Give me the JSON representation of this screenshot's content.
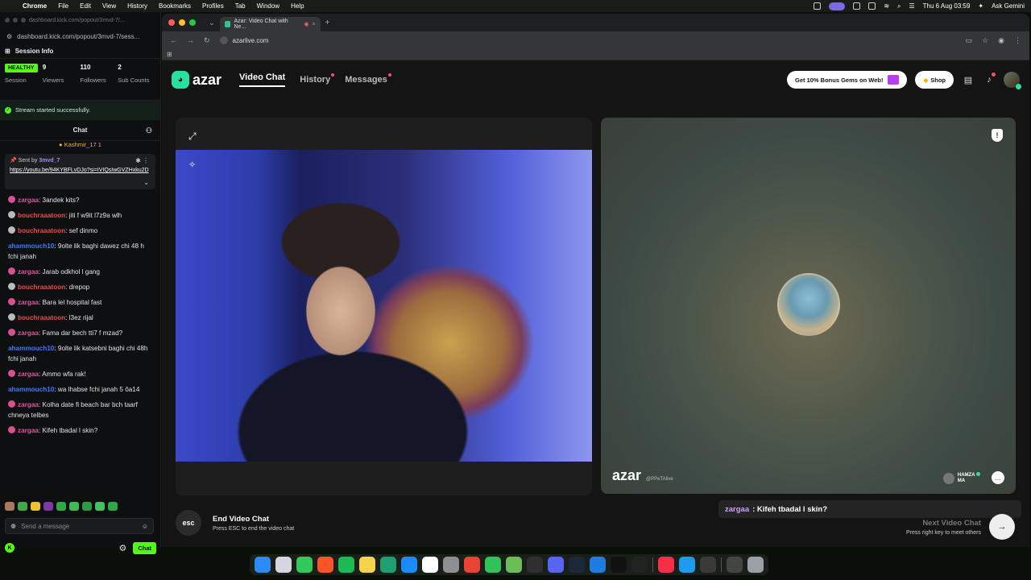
{
  "menubar": {
    "app": "Chrome",
    "items": [
      "File",
      "Edit",
      "View",
      "History",
      "Bookmarks",
      "Profiles",
      "Tab",
      "Window",
      "Help"
    ],
    "clock": "Thu 6 Aug  03:59",
    "gemini": "Ask Gemini"
  },
  "kick": {
    "title_url": "dashboard.kick.com/popout/3mvd-7/...",
    "url": "dashboard.kick.com/popout/3mvd-7/sess...",
    "section_title": "Session Info",
    "stats": [
      {
        "value": "HEALTHY",
        "label": "Session"
      },
      {
        "value": "9",
        "label": "Viewers"
      },
      {
        "value": "110",
        "label": "Followers"
      },
      {
        "value": "2",
        "label": "Sub Counts"
      }
    ],
    "stream_status": "Stream started successfully.",
    "chat_title": "Chat",
    "pinned_user": "Kashmir_17",
    "pinned_count": "1",
    "pinned_sent_by_prefix": "Sent by",
    "pinned_sent_by": "3mvd_7",
    "pinned_link": "https://youtu.be/94KYBFLvDJo?si=IVIQsIwGVZHxku2D",
    "messages": [
      {
        "user": "zargaa",
        "text": "3andek kits?",
        "color": "pink",
        "avatar": "pink"
      },
      {
        "user": "bouchraaatoon",
        "text": "jiti f w9it l7z9a wlh",
        "color": "red",
        "avatar": "grey"
      },
      {
        "user": "bouchraaatoon",
        "text": "sef dinmo",
        "color": "red",
        "avatar": "grey"
      },
      {
        "user": "ahammouch10",
        "text": "9olte lik baghi dawez chi 48 h fchi janah",
        "color": "blue",
        "avatar": ""
      },
      {
        "user": "zargaa",
        "text": "Jarab odkhol l gang",
        "color": "pink",
        "avatar": "pink"
      },
      {
        "user": "bouchraaatoon",
        "text": "drepop",
        "color": "red",
        "avatar": "grey"
      },
      {
        "user": "zargaa",
        "text": "Bara lel hospital fast",
        "color": "pink",
        "avatar": "pink"
      },
      {
        "user": "bouchraaatoon",
        "text": "l3ez rijal",
        "color": "red",
        "avatar": "grey"
      },
      {
        "user": "zargaa",
        "text": "Fama dar bech tti7 f mzad?",
        "color": "pink",
        "avatar": "pink"
      },
      {
        "user": "ahammouch10",
        "text": "9olte lik katsebni baghi chi 48h fchi janah",
        "color": "blue",
        "avatar": ""
      },
      {
        "user": "zargaa",
        "text": "Ammo wfa rak!",
        "color": "pink",
        "avatar": "pink"
      },
      {
        "user": "ahammouch10",
        "text": "wa lhabse fchi janah 5 ôa14",
        "color": "blue",
        "avatar": ""
      },
      {
        "user": "zargaa",
        "text": "Kolha date fi beach bar bch taarf chneya telbes",
        "color": "pink",
        "avatar": "pink"
      },
      {
        "user": "zargaa",
        "text": "Kifeh tbadal l skin?",
        "color": "pink",
        "avatar": "pink"
      }
    ],
    "send_placeholder": "Send a message",
    "chat_button": "Chat"
  },
  "chrome": {
    "tab_title": "Azar: Video Chat with Ne...",
    "url": "azarlive.com"
  },
  "azar": {
    "logo": "azar",
    "nav": [
      {
        "label": "Video Chat",
        "active": true,
        "dot": false
      },
      {
        "label": "History",
        "active": false,
        "dot": true
      },
      {
        "label": "Messages",
        "active": false,
        "dot": true
      }
    ],
    "gems_label": "Get 10% Bonus Gems on Web!",
    "shop_label": "Shop",
    "watermark": "azar",
    "watermark_sub": "@PPeTAlive",
    "partner_name": "HAMZA",
    "partner_country": "MA",
    "overlay_user": "zargaa",
    "overlay_text": ": Kifeh tbadal l skin?",
    "esc_label": "esc",
    "end_title": "End Video Chat",
    "end_sub": "Press ESC to end the video chat",
    "next_title": "Next Video Chat",
    "next_sub": "Press right key to meet others"
  },
  "colors": {
    "kick_green": "#53fc18",
    "azar_green": "#2ae0a0",
    "zargaa_pink": "#e0559a",
    "bouchra_red": "#e74b4b",
    "ahammouch_blue": "#3e7bff"
  },
  "dock_apps": [
    {
      "name": "finder-icon",
      "color": "#2a8cf0"
    },
    {
      "name": "launchpad-icon",
      "color": "#d6d6e0"
    },
    {
      "name": "messages-icon",
      "color": "#34c759"
    },
    {
      "name": "brave-icon",
      "color": "#fb542b"
    },
    {
      "name": "spotify-icon",
      "color": "#1db954"
    },
    {
      "name": "notes-icon",
      "color": "#f5d34b"
    },
    {
      "name": "stocks-icon",
      "color": "#1f9f6f"
    },
    {
      "name": "appstore-icon",
      "color": "#1a8cff"
    },
    {
      "name": "notion-icon",
      "color": "#ffffff"
    },
    {
      "name": "settings-icon",
      "color": "#8e8e93"
    },
    {
      "name": "chrome-icon",
      "color": "#ea4335"
    },
    {
      "name": "facetime-icon",
      "color": "#32c25a"
    },
    {
      "name": "capcut-icon",
      "color": "#6bbd5a"
    },
    {
      "name": "obs-icon",
      "color": "#302e31"
    },
    {
      "name": "discord-icon",
      "color": "#5865f2"
    },
    {
      "name": "steam-icon",
      "color": "#1b2838"
    },
    {
      "name": "xcode-icon",
      "color": "#1c7fe0"
    },
    {
      "name": "tiktok-icon",
      "color": "#111111"
    },
    {
      "name": "capcut2-icon",
      "color": "#222222"
    },
    {
      "name": "music-icon",
      "color": "#fa2d48"
    },
    {
      "name": "safari-icon",
      "color": "#1c9bf0"
    },
    {
      "name": "davinci-icon",
      "color": "#3a3a3a"
    },
    {
      "name": "window-icon",
      "color": "#444444"
    },
    {
      "name": "trash-icon",
      "color": "#9aa0a6"
    }
  ]
}
